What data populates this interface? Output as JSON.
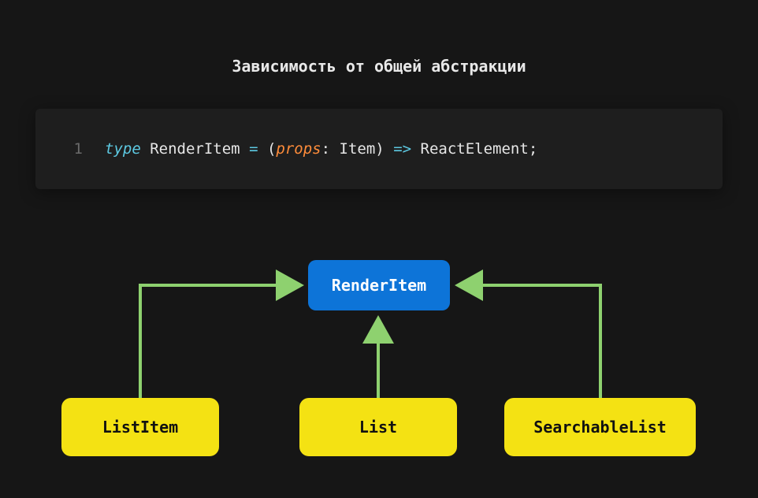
{
  "title": "Зависимость от общей абстракции",
  "code": {
    "line_number": "1",
    "tokens": {
      "type_kw": "type",
      "type_name": "RenderItem",
      "eq": "=",
      "open_paren": "(",
      "param": "props",
      "colon": ":",
      "param_type": "Item",
      "close_paren": ")",
      "arrow": "=>",
      "return_type": "ReactElement",
      "semi": ";"
    }
  },
  "diagram": {
    "root": "RenderItem",
    "children": {
      "left": "ListItem",
      "center": "List",
      "right": "SearchableList"
    }
  }
}
